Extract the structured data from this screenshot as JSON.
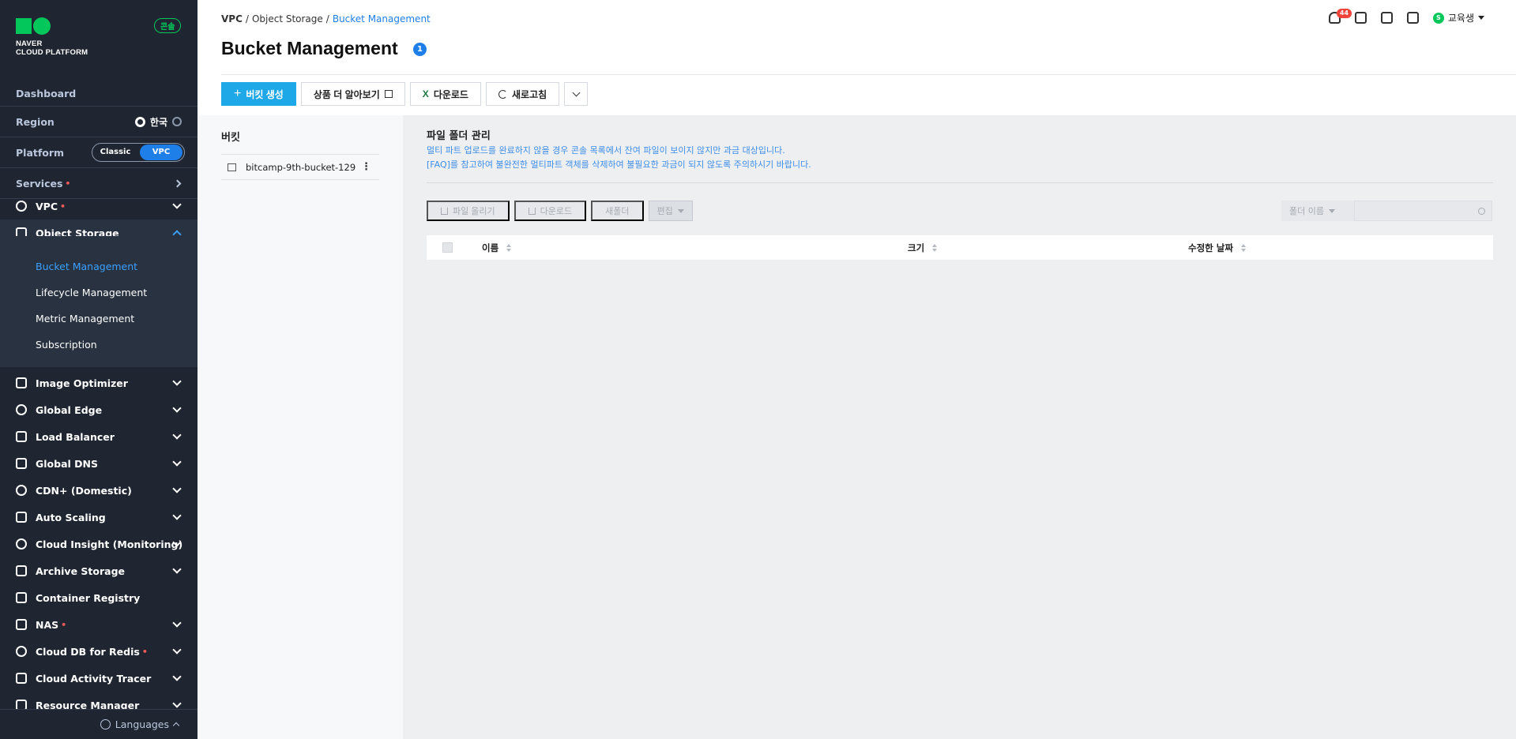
{
  "app": {
    "brand_line1": "NAVER",
    "brand_line2": "CLOUD PLATFORM",
    "console_badge": "콘솔"
  },
  "sidebar": {
    "dashboard": "Dashboard",
    "region_label": "Region",
    "region_value": "한국",
    "platform_label": "Platform",
    "platform_options": [
      "Classic",
      "VPC"
    ],
    "platform_selected": "VPC",
    "services_label": "Services",
    "required_mark": "•",
    "nav": [
      {
        "label": "VPC",
        "icon": "vpc-icon",
        "required": true
      },
      {
        "label": "Object Storage",
        "icon": "object-storage-icon",
        "expanded": true
      },
      {
        "label": "Image Optimizer",
        "icon": "image-optimizer-icon"
      },
      {
        "label": "Global Edge",
        "icon": "global-edge-icon"
      },
      {
        "label": "Load Balancer",
        "icon": "load-balancer-icon"
      },
      {
        "label": "Global DNS",
        "icon": "global-dns-icon"
      },
      {
        "label": "CDN+ (Domestic)",
        "icon": "cdn-icon"
      },
      {
        "label": "Auto Scaling",
        "icon": "auto-scaling-icon"
      },
      {
        "label": "Cloud Insight (Monitoring)",
        "icon": "cloud-insight-icon"
      },
      {
        "label": "Archive Storage",
        "icon": "archive-storage-icon"
      },
      {
        "label": "Container Registry",
        "icon": "container-registry-icon"
      },
      {
        "label": "NAS",
        "icon": "nas-icon",
        "required": true
      },
      {
        "label": "Cloud DB for Redis",
        "icon": "redis-icon",
        "required": true
      },
      {
        "label": "Cloud Activity Tracer",
        "icon": "activity-tracer-icon"
      },
      {
        "label": "Resource Manager",
        "icon": "resource-manager-icon"
      }
    ],
    "sub_items": [
      "Bucket Management",
      "Lifecycle Management",
      "Metric Management",
      "Subscription"
    ],
    "sub_active": "Bucket Management",
    "languages": "Languages"
  },
  "header": {
    "breadcrumb": [
      "VPC",
      "Object Storage",
      "Bucket Management"
    ],
    "title": "Bucket Management",
    "title_badge": "1",
    "notification_count": "44",
    "user_initial": "S",
    "user_name": "교육생"
  },
  "toolbar": {
    "create_bucket": "버킷 생성",
    "learn_more": "상품 더 알아보기",
    "download": "다운로드",
    "refresh": "새로고침"
  },
  "bucket_panel": {
    "title": "버킷",
    "buckets": [
      "bitcamp-9th-bucket-129"
    ]
  },
  "folder": {
    "title": "파일 폴더 관리",
    "notice_1": "멀티 파트 업로드를 완료하지 않을 경우 콘솔 목록에서 잔여 파일이 보이지 않지만 과금 대상입니다.",
    "notice_2": "[FAQ]를 참고하여 불완전한 멀티파트 객체를 삭제하여 불필요한 과금이 되지 않도록 주의하시기 바랍니다.",
    "upload": "파일 올리기",
    "download": "다운로드",
    "new_folder": "새폴더",
    "edit": "편집",
    "search_select": "폴더 이름",
    "search_placeholder": "",
    "columns": [
      "이름",
      "크기",
      "수정한 날짜"
    ]
  },
  "colors": {
    "sidebar_bg": "#1f2631",
    "accent_blue": "#1f7fe8",
    "primary_button": "#1fa8e8",
    "brand_green": "#03c75a"
  }
}
